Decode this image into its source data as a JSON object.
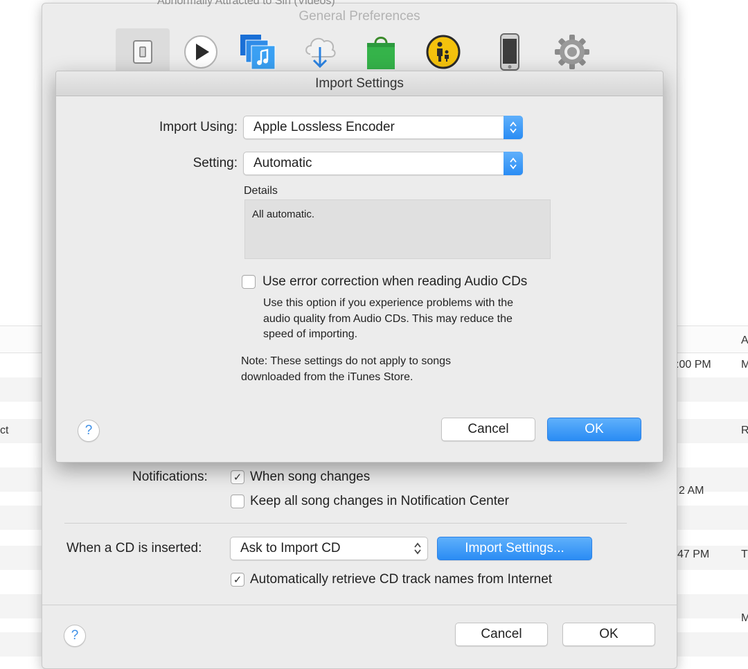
{
  "background": {
    "top_text": "Abnormally Attracted to Sin (Videos)",
    "header_right": "A",
    "rows": [
      {
        "left": "",
        "time": ":00 PM",
        "right": "M"
      },
      {
        "left": "ct",
        "time": "",
        "right": "R"
      },
      {
        "left": "",
        "time": "2 AM",
        "right": ""
      },
      {
        "left": "",
        "time": "47 PM",
        "right": "T"
      },
      {
        "left": "",
        "time": "",
        "right": "M"
      }
    ]
  },
  "prefs_window": {
    "title": "General Preferences",
    "toolbar_icons": [
      "general-icon",
      "playback-icon",
      "sharing-icon",
      "downloads-icon",
      "store-icon",
      "parental-icon",
      "devices-icon",
      "advanced-icon"
    ],
    "notifications": {
      "label": "Notifications:",
      "when_song_changes": "When song changes",
      "when_song_changes_checked": "✓",
      "keep_all": "Keep all song changes in Notification Center"
    },
    "cd": {
      "label": "When a CD is inserted:",
      "action_value": "Ask to Import CD",
      "import_settings_button": "Import Settings...",
      "auto_retrieve": "Automatically retrieve CD track names from Internet",
      "auto_retrieve_checked": "✓"
    },
    "help": "?",
    "cancel": "Cancel",
    "ok": "OK"
  },
  "import_sheet": {
    "title": "Import Settings",
    "import_using_label": "Import Using:",
    "import_using_value": "Apple Lossless Encoder",
    "setting_label": "Setting:",
    "setting_value": "Automatic",
    "details_label": "Details",
    "details_text": "All automatic.",
    "error_correction_label": "Use error correction when reading Audio CDs",
    "error_correction_help_1": "Use this option if you experience problems with the",
    "error_correction_help_2": "audio quality from Audio CDs.  This may reduce the",
    "error_correction_help_3": "speed of importing.",
    "note_1": "Note: These settings do not apply to songs",
    "note_2": "downloaded from the iTunes Store.",
    "help": "?",
    "cancel": "Cancel",
    "ok": "OK"
  },
  "colors": {
    "accent": "#2a8cf4",
    "window_bg": "#ececec"
  }
}
